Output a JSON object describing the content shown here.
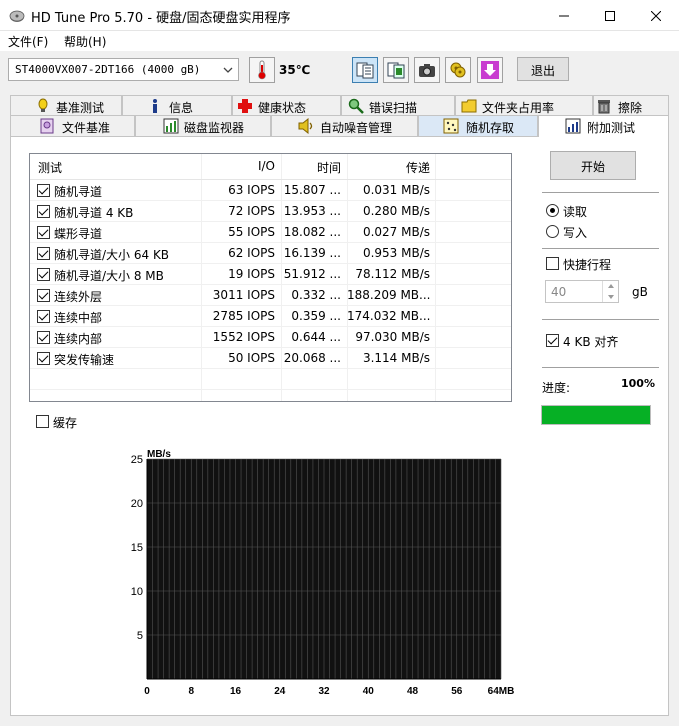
{
  "window": {
    "title": "HD Tune Pro 5.70 - 硬盘/固态硬盘实用程序"
  },
  "menu": {
    "file": "文件(F)",
    "help": "帮助(H)"
  },
  "toolbar": {
    "drive": "ST4000VX007-2DT166 (4000 gB)",
    "temperature": "35℃",
    "exit_label": "退出"
  },
  "tabs_top": [
    {
      "label": "基准测试",
      "icon": "benchmark-icon"
    },
    {
      "label": "信息",
      "icon": "info-icon"
    },
    {
      "label": "健康状态",
      "icon": "health-icon"
    },
    {
      "label": "错误扫描",
      "icon": "error-scan-icon"
    },
    {
      "label": "文件夹占用率",
      "icon": "folder-usage-icon"
    },
    {
      "label": "擦除",
      "icon": "erase-icon"
    }
  ],
  "tabs_bottom": [
    {
      "label": "文件基准",
      "icon": "file-benchmark-icon"
    },
    {
      "label": "磁盘监视器",
      "icon": "disk-monitor-icon"
    },
    {
      "label": "自动噪音管理",
      "icon": "noise-icon"
    },
    {
      "label": "随机存取",
      "icon": "random-access-icon"
    },
    {
      "label": "附加测试",
      "icon": "extra-tests-icon"
    }
  ],
  "table": {
    "headers": [
      "测试",
      "I/O",
      "时间",
      "传递"
    ],
    "rows": [
      {
        "name": "随机寻道",
        "io": "63 IOPS",
        "time": "15.807 ...",
        "transfer": "0.031 MB/s",
        "checked": true
      },
      {
        "name": "随机寻道 4 KB",
        "io": "72 IOPS",
        "time": "13.953 ...",
        "transfer": "0.280 MB/s",
        "checked": true
      },
      {
        "name": "蝶形寻道",
        "io": "55 IOPS",
        "time": "18.082 ...",
        "transfer": "0.027 MB/s",
        "checked": true
      },
      {
        "name": "随机寻道/大小 64 KB",
        "io": "62 IOPS",
        "time": "16.139 ...",
        "transfer": "0.953 MB/s",
        "checked": true
      },
      {
        "name": "随机寻道/大小 8 MB",
        "io": "19 IOPS",
        "time": "51.912 ...",
        "transfer": "78.112 MB/s",
        "checked": true
      },
      {
        "name": "连续外层",
        "io": "3011 IOPS",
        "time": "0.332 ...",
        "transfer": "188.209 MB...",
        "checked": true
      },
      {
        "name": "连续中部",
        "io": "2785 IOPS",
        "time": "0.359 ...",
        "transfer": "174.032 MB...",
        "checked": true
      },
      {
        "name": "连续内部",
        "io": "1552 IOPS",
        "time": "0.644 ...",
        "transfer": "97.030 MB/s",
        "checked": true
      },
      {
        "name": "突发传输速",
        "io": "50 IOPS",
        "time": "20.068 ...",
        "transfer": "3.114 MB/s",
        "checked": true
      }
    ]
  },
  "controls": {
    "start_label": "开始",
    "read_label": "读取",
    "write_label": "写入",
    "read_selected": true,
    "quick_stroke_label": "快捷行程",
    "quick_stroke_checked": false,
    "size_value": "40",
    "size_unit": "gB",
    "align_label": "4 KB 对齐",
    "align_checked": true,
    "progress_label": "进度:",
    "progress_text": "100%",
    "progress_fraction": 1.0,
    "cache_label": "缓存",
    "cache_checked": false
  },
  "colors": {
    "progress_green": "#06b025",
    "chart_bg": "#111111",
    "chart_grid": "#555555"
  },
  "chart_data": {
    "type": "bar",
    "ylabel": "MB/s",
    "xlabel": "",
    "x_unit": "MB",
    "ylim": [
      0,
      25
    ],
    "xlim": [
      0,
      64
    ],
    "y_ticks": [
      5,
      10,
      15,
      20,
      25
    ],
    "x_ticks": [
      0,
      8,
      16,
      24,
      32,
      40,
      48,
      56,
      64
    ],
    "x_tick_labels": [
      "0",
      "8",
      "16",
      "24",
      "32",
      "40",
      "48",
      "56",
      "64MB"
    ],
    "grid": true,
    "series": []
  }
}
